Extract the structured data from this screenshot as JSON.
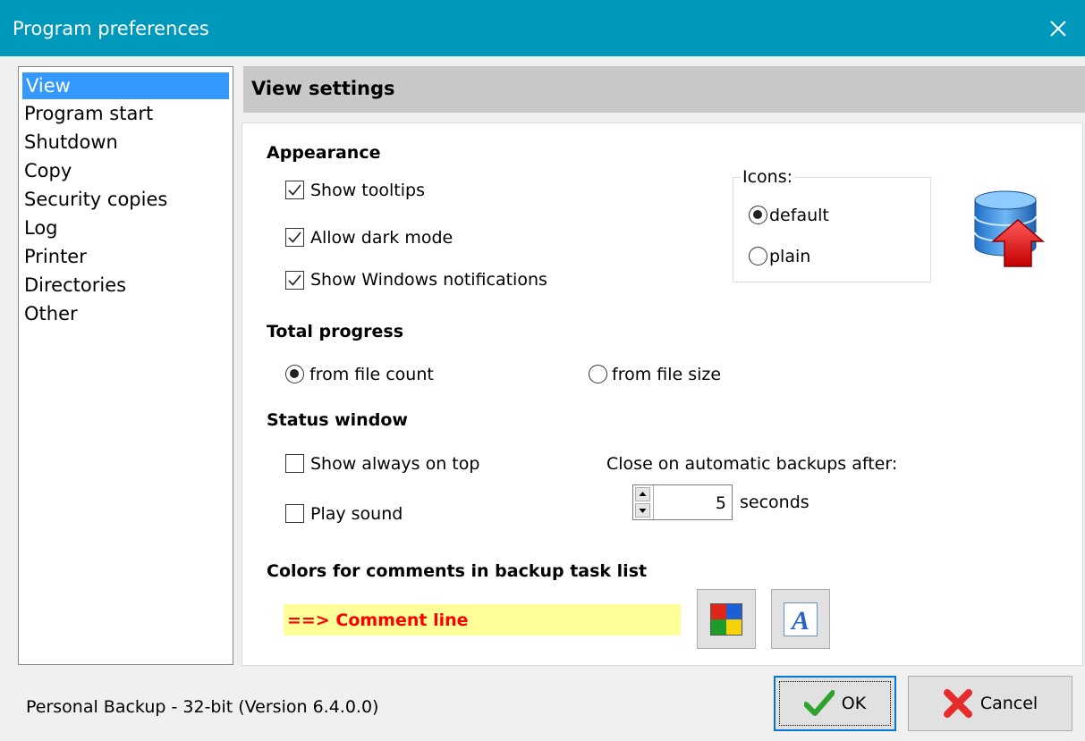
{
  "window": {
    "title": "Program preferences"
  },
  "nav": {
    "items": [
      {
        "label": "View",
        "selected": true
      },
      {
        "label": "Program start"
      },
      {
        "label": "Shutdown"
      },
      {
        "label": "Copy"
      },
      {
        "label": "Security copies"
      },
      {
        "label": "Log"
      },
      {
        "label": "Printer"
      },
      {
        "label": "Directories"
      },
      {
        "label": "Other"
      }
    ]
  },
  "header": {
    "title": "View settings"
  },
  "appearance": {
    "heading": "Appearance",
    "show_tooltips": {
      "label": "Show tooltips",
      "checked": true
    },
    "allow_dark_mode": {
      "label": "Allow dark mode",
      "checked": true
    },
    "show_notifications": {
      "label": "Show Windows notifications",
      "checked": true
    },
    "icons": {
      "label": "Icons:",
      "options": [
        {
          "label": "default",
          "selected": true
        },
        {
          "label": "plain",
          "selected": false
        }
      ]
    }
  },
  "total_progress": {
    "heading": "Total progress",
    "options": [
      {
        "label": "from file count",
        "selected": true
      },
      {
        "label": "from file size",
        "selected": false
      }
    ]
  },
  "status_window": {
    "heading": "Status window",
    "always_on_top": {
      "label": "Show always on top",
      "checked": false
    },
    "play_sound": {
      "label": "Play sound",
      "checked": false
    },
    "close_label": "Close on automatic backups after:",
    "seconds_value": "5",
    "seconds_unit": "seconds"
  },
  "colors": {
    "heading": "Colors for comments in backup task list",
    "sample_text": "==> Comment line",
    "sample_bg": "#ffff99",
    "sample_fg": "#ff0000"
  },
  "footer": {
    "version": "Personal Backup - 32-bit (Version 6.4.0.0)",
    "ok_label": "OK",
    "cancel_label": "Cancel"
  },
  "colors_ui": {
    "titlebar": "#0099bc",
    "selection": "#3399ff"
  }
}
